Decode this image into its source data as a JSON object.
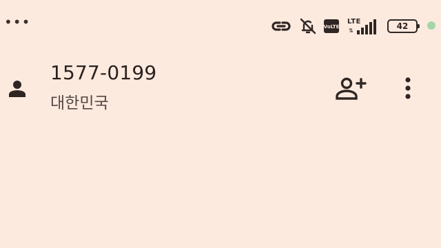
{
  "status_bar": {
    "overflow_dots": "•••",
    "icons": [
      "link-icon",
      "bell-off-icon",
      "volte-icon",
      "lte-signal-icon",
      "battery-icon",
      "privacy-indicator-dot"
    ],
    "volte_top": "Vo",
    "volte_bottom": "LTE",
    "network_label": "LTE",
    "network_arrows": "⇅",
    "battery_level": "42",
    "privacy_dot_color": "#a5d6a7"
  },
  "contact": {
    "phone_number": "1577-0199",
    "country": "대한민국",
    "icons": [
      "person-icon",
      "add-contact-icon",
      "more-vert-icon"
    ]
  },
  "colors": {
    "background": "#fdeadf",
    "foreground": "#2f2623"
  }
}
